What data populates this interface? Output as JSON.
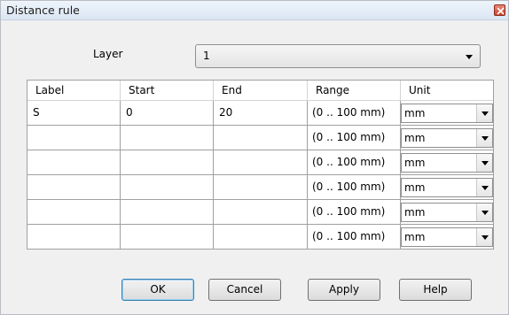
{
  "window": {
    "title": "Distance rule"
  },
  "layer": {
    "label": "Layer",
    "value": "1"
  },
  "grid": {
    "columns": [
      "Label",
      "Start",
      "End",
      "Range",
      "Unit"
    ],
    "rows": [
      {
        "label": "S",
        "start": "0",
        "end": "20",
        "range": "(0 .. 100 mm)",
        "unit": "mm"
      },
      {
        "label": "",
        "start": "",
        "end": "",
        "range": "(0 .. 100 mm)",
        "unit": "mm"
      },
      {
        "label": "",
        "start": "",
        "end": "",
        "range": "(0 .. 100 mm)",
        "unit": "mm"
      },
      {
        "label": "",
        "start": "",
        "end": "",
        "range": "(0 .. 100 mm)",
        "unit": "mm"
      },
      {
        "label": "",
        "start": "",
        "end": "",
        "range": "(0 .. 100 mm)",
        "unit": "mm"
      },
      {
        "label": "",
        "start": "",
        "end": "",
        "range": "(0 .. 100 mm)",
        "unit": "mm"
      }
    ]
  },
  "buttons": {
    "ok": "OK",
    "cancel": "Cancel",
    "apply": "Apply",
    "help": "Help"
  },
  "icons": {
    "close": "close-icon",
    "dropdown": "chevron-down-icon"
  }
}
